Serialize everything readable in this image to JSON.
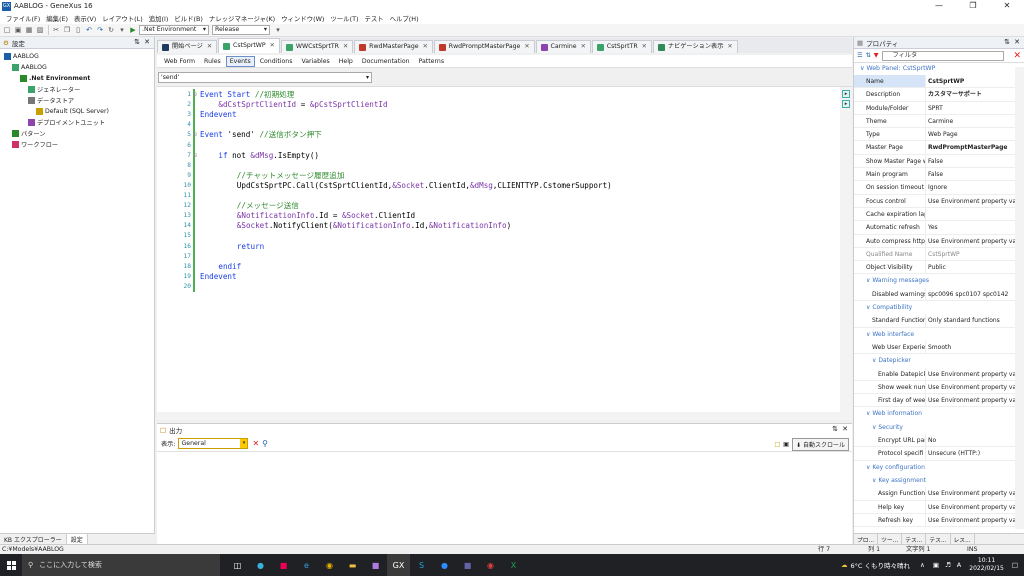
{
  "window": {
    "title": "AABLOG - GeneXus 16",
    "app_icon": "GX"
  },
  "menu": [
    "ファイル(F)",
    "編集(E)",
    "表示(V)",
    "レイアウト(L)",
    "追加(I)",
    "ビルド(B)",
    "ナレッジマネージャ(K)",
    "ウィンドウ(W)",
    "ツール(T)",
    "テスト",
    "ヘルプ(H)"
  ],
  "toolbar": {
    "environment": ".Net Environment",
    "configuration": "Release"
  },
  "left_panel": {
    "title": "設定",
    "tree": [
      {
        "label": "AABLOG",
        "level": 0,
        "icon": "kb-icon"
      },
      {
        "label": "AABLOG",
        "level": 1,
        "icon": "version-icon"
      },
      {
        "label": ".Net Environment",
        "level": 2,
        "icon": "environment-icon"
      },
      {
        "label": "ジェネレーター",
        "level": 3,
        "icon": "generator-icon"
      },
      {
        "label": "データストア",
        "level": 3,
        "icon": "datastore-icon"
      },
      {
        "label": "Default (SQL Server)",
        "level": 4,
        "icon": "database-icon"
      },
      {
        "label": "デプロイメントユニット",
        "level": 3,
        "icon": "deploy-icon"
      },
      {
        "label": "パターン",
        "level": 1,
        "icon": "pattern-icon"
      },
      {
        "label": "ワークフロー",
        "level": 1,
        "icon": "workflow-icon"
      }
    ],
    "bottom_tabs": [
      "KB エクスプローラー",
      "設定"
    ]
  },
  "doc_tabs": [
    {
      "label": "開始ページ",
      "color": "#1e3a5f"
    },
    {
      "label": "CstSprtWP",
      "color": "#3aa36a",
      "active": true
    },
    {
      "label": "WWCstSprtTR",
      "color": "#3aa36a"
    },
    {
      "label": "RwdMasterPage",
      "color": "#c0392b"
    },
    {
      "label": "RwdPromptMasterPage",
      "color": "#c0392b"
    },
    {
      "label": "Carmine",
      "color": "#8e44ad"
    },
    {
      "label": "CstSprtTR",
      "color": "#3aa36a"
    },
    {
      "label": "ナビゲーション表示",
      "color": "#2e8b57"
    }
  ],
  "sub_tabs": [
    "Web Form",
    "Rules",
    "Events",
    "Conditions",
    "Variables",
    "Help",
    "Documentation",
    "Patterns"
  ],
  "sub_tab_active": "Events",
  "event_selector": "'send'",
  "code": [
    {
      "n": "1",
      "indent": 0,
      "fold": true,
      "parts": [
        {
          "t": "Event Start ",
          "c": "kw"
        },
        {
          "t": "//初期処理",
          "c": "cm"
        }
      ]
    },
    {
      "n": "2",
      "indent": 4,
      "parts": [
        {
          "t": "&dCstSprtClientId",
          "c": "var"
        },
        {
          "t": " = ",
          "c": "plain"
        },
        {
          "t": "&pCstSprtClientId",
          "c": "var"
        }
      ]
    },
    {
      "n": "3",
      "indent": 0,
      "parts": [
        {
          "t": "Endevent",
          "c": "kw"
        }
      ]
    },
    {
      "n": "4",
      "indent": 0,
      "parts": []
    },
    {
      "n": "5",
      "indent": 0,
      "fold": true,
      "parts": [
        {
          "t": "Event ",
          "c": "kw"
        },
        {
          "t": "'send' ",
          "c": "plain"
        },
        {
          "t": "//送信ボタン押下",
          "c": "cm"
        }
      ]
    },
    {
      "n": "6",
      "indent": 0,
      "parts": []
    },
    {
      "n": "7",
      "indent": 4,
      "fold": true,
      "parts": [
        {
          "t": "if ",
          "c": "kw"
        },
        {
          "t": "not ",
          "c": "plain"
        },
        {
          "t": "&dMsg",
          "c": "var"
        },
        {
          "t": ".IsEmpty()",
          "c": "plain"
        }
      ]
    },
    {
      "n": "8",
      "indent": 0,
      "parts": []
    },
    {
      "n": "9",
      "indent": 8,
      "parts": [
        {
          "t": "//チャットメッセージ履歴追加",
          "c": "cm"
        }
      ]
    },
    {
      "n": "10",
      "indent": 8,
      "parts": [
        {
          "t": "UpdCstSprtPC.Call(CstSprtClientId,",
          "c": "plain"
        },
        {
          "t": "&Socket",
          "c": "var"
        },
        {
          "t": ".ClientId,",
          "c": "plain"
        },
        {
          "t": "&dMsg",
          "c": "var"
        },
        {
          "t": ",CLIENTTYP.CstomerSupport)",
          "c": "plain"
        }
      ]
    },
    {
      "n": "11",
      "indent": 0,
      "parts": []
    },
    {
      "n": "12",
      "indent": 8,
      "parts": [
        {
          "t": "//メッセージ送信",
          "c": "cm"
        }
      ]
    },
    {
      "n": "13",
      "indent": 8,
      "parts": [
        {
          "t": "&NotificationInfo",
          "c": "var"
        },
        {
          "t": ".Id = ",
          "c": "plain"
        },
        {
          "t": "&Socket",
          "c": "var"
        },
        {
          "t": ".ClientId",
          "c": "plain"
        }
      ]
    },
    {
      "n": "14",
      "indent": 8,
      "parts": [
        {
          "t": "&Socket",
          "c": "var"
        },
        {
          "t": ".NotifyClient(",
          "c": "plain"
        },
        {
          "t": "&NotificationInfo",
          "c": "var"
        },
        {
          "t": ".Id,",
          "c": "plain"
        },
        {
          "t": "&NotificationInfo",
          "c": "var"
        },
        {
          "t": ")",
          "c": "plain"
        }
      ]
    },
    {
      "n": "15",
      "indent": 0,
      "parts": []
    },
    {
      "n": "16",
      "indent": 8,
      "parts": [
        {
          "t": "return",
          "c": "kw"
        }
      ]
    },
    {
      "n": "17",
      "indent": 0,
      "parts": []
    },
    {
      "n": "18",
      "indent": 4,
      "parts": [
        {
          "t": "endif",
          "c": "kw"
        }
      ]
    },
    {
      "n": "19",
      "indent": 0,
      "parts": [
        {
          "t": "Endevent",
          "c": "kw"
        }
      ]
    },
    {
      "n": "20",
      "indent": 0,
      "parts": []
    }
  ],
  "output": {
    "title": "出力",
    "show_label": "表示:",
    "selected": "General",
    "autoscroll_label": "自動スクロール"
  },
  "properties": {
    "title": "プロパティ",
    "filter_placeholder": "フィルタ",
    "section_title": "Web Panel: CstSprtWP",
    "rows": [
      {
        "type": "row",
        "k": "Name",
        "v": "CstSprtWP",
        "bold": true,
        "sel": true
      },
      {
        "type": "row",
        "k": "Description",
        "v": "カスタマーサポート",
        "bold": true
      },
      {
        "type": "row",
        "k": "Module/Folder",
        "v": "SPRT"
      },
      {
        "type": "row",
        "k": "Theme",
        "v": "Carmine"
      },
      {
        "type": "row",
        "k": "Type",
        "v": "Web Page"
      },
      {
        "type": "row",
        "k": "Master Page",
        "v": "RwdPromptMasterPage",
        "bold": true
      },
      {
        "type": "row",
        "k": "Show Master Page w",
        "v": "False"
      },
      {
        "type": "row",
        "k": "Main program",
        "v": "False"
      },
      {
        "type": "row",
        "k": "On session timeout",
        "v": "Ignore"
      },
      {
        "type": "row",
        "k": "Focus control",
        "v": "Use Environment property va..."
      },
      {
        "type": "row",
        "k": "Cache expiration lap",
        "v": ""
      },
      {
        "type": "row",
        "k": "Automatic refresh",
        "v": "Yes"
      },
      {
        "type": "row",
        "k": "Auto compress http",
        "v": "Use Environment property va..."
      },
      {
        "type": "row",
        "k": "Qualified Name",
        "v": "CstSprtWP",
        "dim": true
      },
      {
        "type": "row",
        "k": "Object Visibility",
        "v": "Public"
      },
      {
        "type": "section",
        "label": "Warning messages",
        "level": 1
      },
      {
        "type": "row",
        "k": "Disabled warnings",
        "v": "spc0096 spc0107 spc0142",
        "level": 1
      },
      {
        "type": "section",
        "label": "Compatibility",
        "level": 1
      },
      {
        "type": "row",
        "k": "Standard Function",
        "v": "Only standard functions",
        "level": 1
      },
      {
        "type": "section",
        "label": "Web interface",
        "level": 1
      },
      {
        "type": "row",
        "k": "Web User Experien",
        "v": "Smooth",
        "level": 1
      },
      {
        "type": "section",
        "label": "Datepicker",
        "level": 2
      },
      {
        "type": "row",
        "k": "Enable Datepick",
        "v": "Use Environment property va...",
        "level": 2
      },
      {
        "type": "row",
        "k": "Show week num",
        "v": "Use Environment property va...",
        "level": 2
      },
      {
        "type": "row",
        "k": "First day of wee",
        "v": "Use Environment property va...",
        "level": 2
      },
      {
        "type": "section",
        "label": "Web information",
        "level": 1
      },
      {
        "type": "section",
        "label": "Security",
        "level": 2
      },
      {
        "type": "row",
        "k": "Encrypt URL par",
        "v": "No",
        "level": 2
      },
      {
        "type": "row",
        "k": "Protocol specifi",
        "v": "Unsecure (HTTP:)",
        "level": 2
      },
      {
        "type": "section",
        "label": "Key configuration",
        "level": 1
      },
      {
        "type": "section",
        "label": "Key assignment",
        "level": 2
      },
      {
        "type": "row",
        "k": "Assign Function",
        "v": "Use Environment property va...",
        "level": 2
      },
      {
        "type": "row",
        "k": "Help key",
        "v": "Use Environment property va...",
        "level": 2
      },
      {
        "type": "row",
        "k": "Refresh key",
        "v": "Use Environment property va...",
        "level": 2
      }
    ],
    "bottom_tabs": [
      "プロ...",
      "ツー...",
      "テス...",
      "テス...",
      "レス..."
    ]
  },
  "status": {
    "path": "C:¥Models¥AABLOG",
    "line": "行 7",
    "col": "列 1",
    "char": "文字列 1",
    "mode": "INS"
  },
  "taskbar": {
    "search_placeholder": "ここに入力して検索",
    "weather": "6°C くもり時々晴れ",
    "ime": "A",
    "time": "10:11",
    "date": "2022/02/15"
  }
}
